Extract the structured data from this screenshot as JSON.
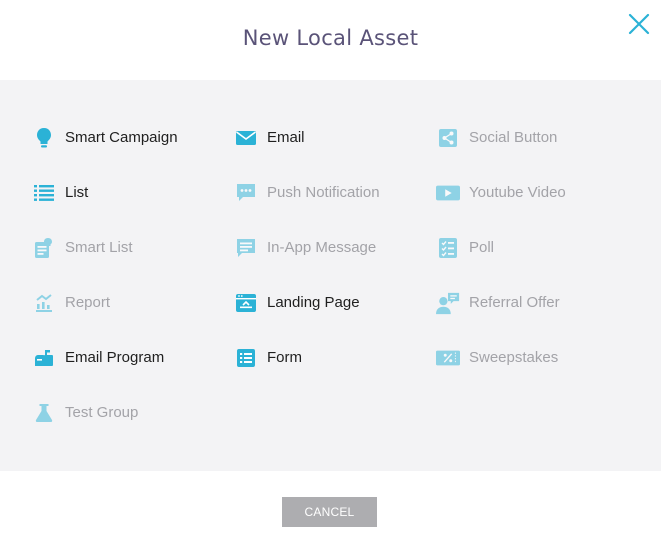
{
  "dialog": {
    "title": "New Local Asset",
    "cancel_label": "CANCEL"
  },
  "colors": {
    "accent": "#2bb2d6",
    "enabled_text": "#1f1f1f",
    "disabled_text": "#a3a3a8",
    "title_text": "#5a5378",
    "body_bg": "#f3f3f5",
    "cancel_bg": "#adadb0"
  },
  "assets": {
    "col1": [
      {
        "label": "Smart Campaign",
        "icon": "lightbulb-icon",
        "enabled": true
      },
      {
        "label": "List",
        "icon": "list-icon",
        "enabled": true
      },
      {
        "label": "Smart List",
        "icon": "smart-list-icon",
        "enabled": false
      },
      {
        "label": "Report",
        "icon": "report-chart-icon",
        "enabled": false
      },
      {
        "label": "Email Program",
        "icon": "mailbox-icon",
        "enabled": true
      },
      {
        "label": "Test Group",
        "icon": "flask-icon",
        "enabled": false
      }
    ],
    "col2": [
      {
        "label": "Email",
        "icon": "envelope-icon",
        "enabled": true
      },
      {
        "label": "Push Notification",
        "icon": "push-notification-icon",
        "enabled": false
      },
      {
        "label": "In-App Message",
        "icon": "chat-message-icon",
        "enabled": false
      },
      {
        "label": "Landing Page",
        "icon": "landing-page-icon",
        "enabled": true
      },
      {
        "label": "Form",
        "icon": "form-icon",
        "enabled": true
      }
    ],
    "col3": [
      {
        "label": "Social Button",
        "icon": "share-icon",
        "enabled": false
      },
      {
        "label": "Youtube Video",
        "icon": "video-play-icon",
        "enabled": false
      },
      {
        "label": "Poll",
        "icon": "poll-checklist-icon",
        "enabled": false
      },
      {
        "label": "Referral Offer",
        "icon": "referral-person-icon",
        "enabled": false
      },
      {
        "label": "Sweepstakes",
        "icon": "ticket-percent-icon",
        "enabled": false
      }
    ]
  }
}
